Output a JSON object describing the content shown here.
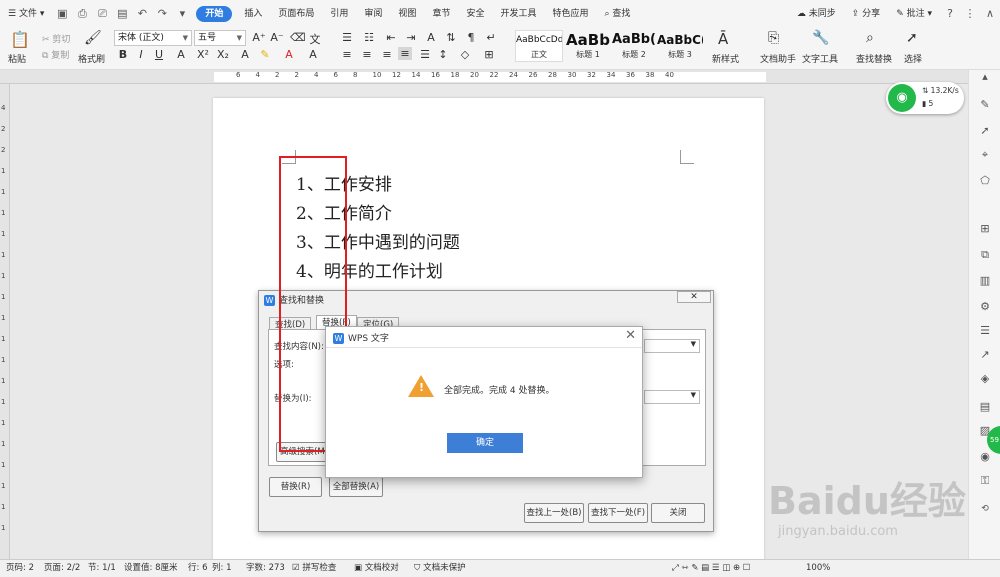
{
  "menubar": {
    "file": "文件",
    "tabs": [
      "开始",
      "插入",
      "页面布局",
      "引用",
      "审阅",
      "视图",
      "章节",
      "安全",
      "开发工具",
      "特色应用"
    ],
    "search": "查找",
    "sync": "未同步",
    "share": "分享",
    "comment": "批注"
  },
  "ribbon": {
    "paste": "粘贴",
    "cut": "剪切",
    "copy": "复制",
    "format_painter": "格式刷",
    "font": "宋体 (正文)",
    "size": "五号",
    "styles": [
      {
        "preview": "AaBbCcDd",
        "label": "正文"
      },
      {
        "preview": "AaBb",
        "label": "标题 1"
      },
      {
        "preview": "AaBb(",
        "label": "标题 2"
      },
      {
        "preview": "AaBbC(",
        "label": "标题 3"
      }
    ],
    "new_style": "新样式",
    "doc_assistant": "文档助手",
    "text_tools": "文字工具",
    "find_replace": "查找替换",
    "select": "选择"
  },
  "ruler": {
    "ticks": [
      "6",
      "4",
      "2",
      "2",
      "4",
      "6",
      "8",
      "10",
      "12",
      "14",
      "16",
      "18",
      "20",
      "22",
      "24",
      "26",
      "28",
      "30",
      "32",
      "34",
      "36",
      "38",
      "40"
    ]
  },
  "vruler": {
    "ticks": [
      "4",
      "2",
      "2",
      "1",
      "1",
      "1",
      "1",
      "1",
      "1",
      "1",
      "1",
      "1",
      "1",
      "1",
      "1",
      "1",
      "1",
      "1",
      "1",
      "1",
      "1"
    ]
  },
  "document": {
    "items": [
      "1、工作安排",
      "2、工作简介",
      "3、工作中遇到的问题",
      "4、明年的工作计划"
    ]
  },
  "network": {
    "speed": "13.2K/s",
    "count": "5"
  },
  "find_dialog": {
    "title": "查找和替换",
    "tabs": [
      "查找(D)",
      "替换(P)",
      "定位(G)"
    ],
    "find_label": "查找内容(N):",
    "options_label": "选项:",
    "replace_label": "替换为(I):",
    "advanced": "高级搜索(M)",
    "replace_btn": "替换(R)",
    "replace_all_btn": "全部替换(A)",
    "find_prev": "查找上一处(B)",
    "find_next": "查找下一处(F)",
    "close": "关闭"
  },
  "alert": {
    "title": "WPS 文字",
    "message": "全部完成。完成 4 处替换。",
    "ok": "确定"
  },
  "status": {
    "page_num": "页码: 2",
    "pages": "页面: 2/2",
    "section": "节: 1/1",
    "setting": "设置值: 8厘米",
    "row": "行: 6",
    "col": "列: 1",
    "words": "字数: 273",
    "spell": "拼写检查",
    "proof": "文档校对",
    "protect": "文档未保护",
    "zoom": "100%"
  },
  "watermark": {
    "brand": "Baidu经验",
    "url": "jingyan.baidu.com"
  },
  "colors": {
    "accent": "#2f7de1",
    "red_box": "#e02020",
    "ok_button": "#3d7fd6",
    "network": "#23b84a"
  }
}
